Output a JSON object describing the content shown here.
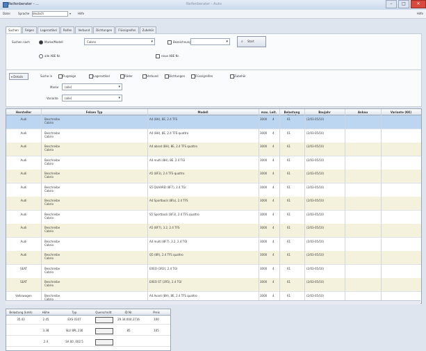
{
  "title": "Reifenberater - ...",
  "app_name": "Reifenberater - Auto",
  "menu": {
    "file": "Datei",
    "sprache": "Sprache",
    "sprache_value": "deutsch",
    "help": "Hilfe"
  },
  "tabs": [
    "Suchen",
    "Felgen",
    "Lagerartikel",
    "Reifen",
    "Verbund",
    "Dichtungen",
    "Flüssigreifen",
    "Zubehör"
  ],
  "search": {
    "label": "Suchen nach",
    "radio1": "Marke/Modell",
    "radio2": "alle ABE Nr.",
    "model_value": "Cabrio",
    "bezeichnung_label": "Bezeichnung",
    "neue_label": "neue ABE Nr.",
    "button": "Start"
  },
  "filter": {
    "details_button": "Details",
    "suche_label": "Suche in",
    "checks": [
      "Flugzeige",
      "Lagerartikel",
      "Räder",
      "Verbund",
      "Dichtungen",
      "Flüssigreifen",
      "Zubehör"
    ],
    "marke_label": "Marke",
    "marke_value": "(alle)",
    "variante_label": "Variante",
    "variante_value": "(alle)"
  },
  "grid": {
    "columns": [
      "Hersteller",
      "Felsen Typ",
      "Modell",
      "max. Leit.",
      "Belastung (max)",
      "Baujahr",
      "Anbau",
      "Variante (KK)"
    ],
    "rows": [
      {
        "h": "Audi",
        "t": "Beschreibe\nCabrio",
        "m": "A4 (8H), 8E, 2.4 TFS",
        "v": "3000",
        "k": "4",
        "b": "61",
        "y": "(2/03-05/10)"
      },
      {
        "h": "Audi",
        "t": "Beschreibe\nCabrio",
        "m": "A4 (8H), 8E, 2.4 TFS quattro",
        "v": "3000",
        "k": "4",
        "b": "61",
        "y": "(2/03-05/10)"
      },
      {
        "h": "Audi",
        "t": "Beschreibe\nCabrio",
        "m": "A4 abrod (8H), 8E, 2.4 TFS quattro",
        "v": "3000",
        "k": "4",
        "b": "61",
        "y": "(2/03-05/10)"
      },
      {
        "h": "Audi",
        "t": "Beschreibe\nCabrio",
        "m": "A4 multi (8H), 8E, 2.4 TGI",
        "v": "3000",
        "k": "4",
        "b": "61",
        "y": "(2/03-05/10)"
      },
      {
        "h": "Audi",
        "t": "Beschreibe\nCabrio",
        "m": "A5 (8F3), 2.4 TFS quattro",
        "v": "3000",
        "k": "4",
        "b": "61",
        "y": "(2/03-05/10)"
      },
      {
        "h": "Audi",
        "t": "Beschreibe\nCabrio",
        "m": "S5 QUAARD (8F7), 2.4 TGI",
        "v": "3000",
        "k": "4",
        "b": "61",
        "y": "(2/03-05/10)"
      },
      {
        "h": "Audi",
        "t": "Beschreibe\nCabrio",
        "m": "A4 Sportback (8Fa), 2.4 TFS",
        "v": "3000",
        "k": "4",
        "b": "61",
        "y": "(2/03-05/10)"
      },
      {
        "h": "Audi",
        "t": "Beschreibe\nCabrio",
        "m": "S5 Sportback (8F3), 2.4 TFS quattro",
        "v": "3000",
        "k": "4",
        "b": "61",
        "y": "(2/03-05/10)"
      },
      {
        "h": "Audi",
        "t": "Beschreibe\nCabrio",
        "m": "A5 (8F7), 3.2, 2.4 TFS",
        "v": "3000",
        "k": "4",
        "b": "61",
        "y": "(2/03-05/10)"
      },
      {
        "h": "Audi",
        "t": "Beschreibe\nCabrio",
        "m": "A4 multi (8F7), 3.2, 2.4 TGI",
        "v": "3000",
        "k": "4",
        "b": "61",
        "y": "(2/03-05/10)"
      },
      {
        "h": "Audi",
        "t": "Beschreibe\nCabrio",
        "m": "Q5 (8R), 2.4 TFS quattro",
        "v": "3000",
        "k": "4",
        "b": "61",
        "y": "(2/03-05/10)"
      },
      {
        "h": "SEAT",
        "t": "Beschreibe\nCabrio",
        "m": "EXEO (3R2), 2.4 TGI",
        "v": "3000",
        "k": "4",
        "b": "61",
        "y": "(2/03-05/10)"
      },
      {
        "h": "SEAT",
        "t": "Beschreibe\nCabrio",
        "m": "EXEO ST (3R5), 2.4 TGI",
        "v": "3000",
        "k": "4",
        "b": "61",
        "y": "(2/03-05/10)"
      },
      {
        "h": "Volkswagen",
        "t": "Beschreibe\nCabrio",
        "m": "A4 Avant (8H), 8E, 2.4 TFS quattro",
        "v": "3000",
        "k": "4",
        "b": "61",
        "y": "(2/03-05/10)"
      }
    ]
  },
  "detail_table": {
    "columns": [
      "Belastung (kmh)",
      "Höhe",
      "Typ",
      "Querschnitt",
      "ID Nr.",
      "Preis"
    ],
    "rows": [
      {
        "a": "35.43",
        "b": "2.45",
        "c": "EXS 0107",
        "e": "29.34.004.2716",
        "f": "100"
      },
      {
        "a": "",
        "b": "3.38",
        "c": "SLU 8PL 236",
        "e": "85",
        "f": "105"
      },
      {
        "a": "",
        "b": "2.4",
        "c": "SA 00 ,002.5",
        "e": "",
        "f": ""
      }
    ]
  }
}
